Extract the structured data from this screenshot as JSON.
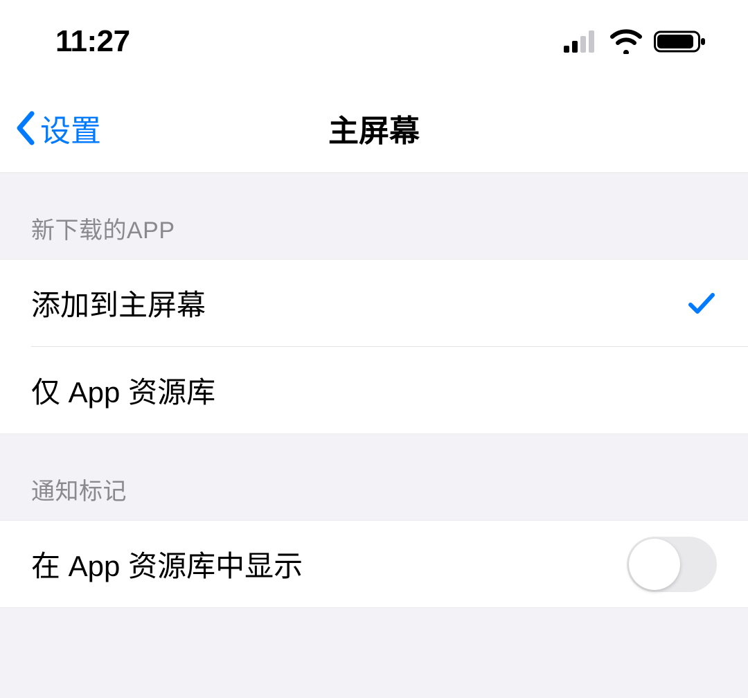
{
  "status_bar": {
    "time": "11:27"
  },
  "nav": {
    "back_label": "设置",
    "title": "主屏幕"
  },
  "sections": {
    "new_apps": {
      "header": "新下载的APP",
      "options": [
        {
          "label": "添加到主屏幕",
          "selected": true
        },
        {
          "label": "仅 App 资源库",
          "selected": false
        }
      ]
    },
    "notification_badges": {
      "header": "通知标记",
      "rows": [
        {
          "label": "在 App 资源库中显示",
          "toggle": false
        }
      ]
    }
  },
  "colors": {
    "accent": "#007aff",
    "background": "#f2f2f7",
    "row_bg": "#ffffff",
    "secondary_text": "#8a8a8e"
  }
}
